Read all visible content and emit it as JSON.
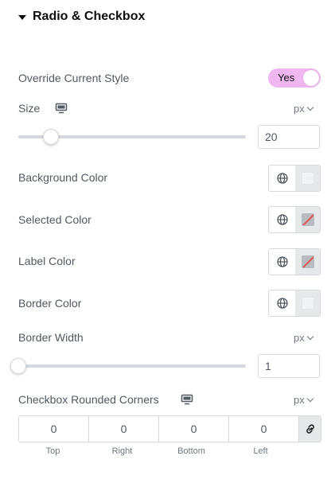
{
  "section": {
    "title": "Radio & Checkbox"
  },
  "override": {
    "label": "Override Current Style",
    "toggle_text": "Yes",
    "toggle_on": true
  },
  "size": {
    "label": "Size",
    "unit": "px",
    "value": "20",
    "slider_fraction": 0.14
  },
  "colors": [
    {
      "label": "Background Color",
      "swatch": "#f1f2f3",
      "empty": false
    },
    {
      "label": "Selected Color",
      "swatch": "none",
      "empty": true
    },
    {
      "label": "Label Color",
      "swatch": "none",
      "empty": true
    },
    {
      "label": "Border Color",
      "swatch": "#f1f2f3",
      "empty": false
    }
  ],
  "border_width": {
    "label": "Border Width",
    "unit": "px",
    "value": "1",
    "slider_fraction": 0.0
  },
  "corners": {
    "label": "Checkbox Rounded Corners",
    "unit": "px",
    "values": [
      "0",
      "0",
      "0",
      "0"
    ],
    "labels": [
      "Top",
      "Right",
      "Bottom",
      "Left"
    ]
  },
  "theme": {
    "accent": "#f0b6f0",
    "text": "#515962",
    "border": "#d5d8dc"
  }
}
